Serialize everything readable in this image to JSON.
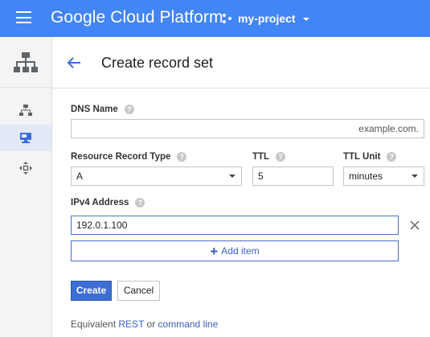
{
  "topbar": {
    "menu_icon": "hamburger-menu-icon",
    "brand": "Google Cloud Platform",
    "project_icon": "project-hierarchy-icon",
    "project_name": "my-project"
  },
  "nav": {
    "header_icon": "network-services-icon",
    "items": [
      {
        "icon": "hierarchy-icon",
        "active": false
      },
      {
        "icon": "monitor-icon",
        "active": true
      },
      {
        "icon": "arrows-move-icon",
        "active": false
      }
    ]
  },
  "header": {
    "back_icon": "arrow-back-icon",
    "title": "Create record set"
  },
  "form": {
    "dns_name": {
      "label": "DNS Name",
      "value": "",
      "suffix": "example.com."
    },
    "record_type": {
      "label": "Resource Record Type",
      "selected": "A"
    },
    "ttl": {
      "label": "TTL",
      "value": "5"
    },
    "ttl_unit": {
      "label": "TTL Unit",
      "selected": "minutes"
    },
    "ipv4": {
      "label": "IPv4 Address",
      "value": "192.0.1.100"
    },
    "help_icon": "help-circle-icon",
    "remove_icon": "close-icon",
    "add_item": "Add item",
    "create": "Create",
    "cancel": "Cancel"
  },
  "footer": {
    "prefix": "Equivalent",
    "rest": "REST",
    "or": "or",
    "command_line": "command line"
  },
  "colors": {
    "topbar": "#4285f4",
    "accent": "#3d6ed6",
    "link": "#3b5fc0"
  }
}
